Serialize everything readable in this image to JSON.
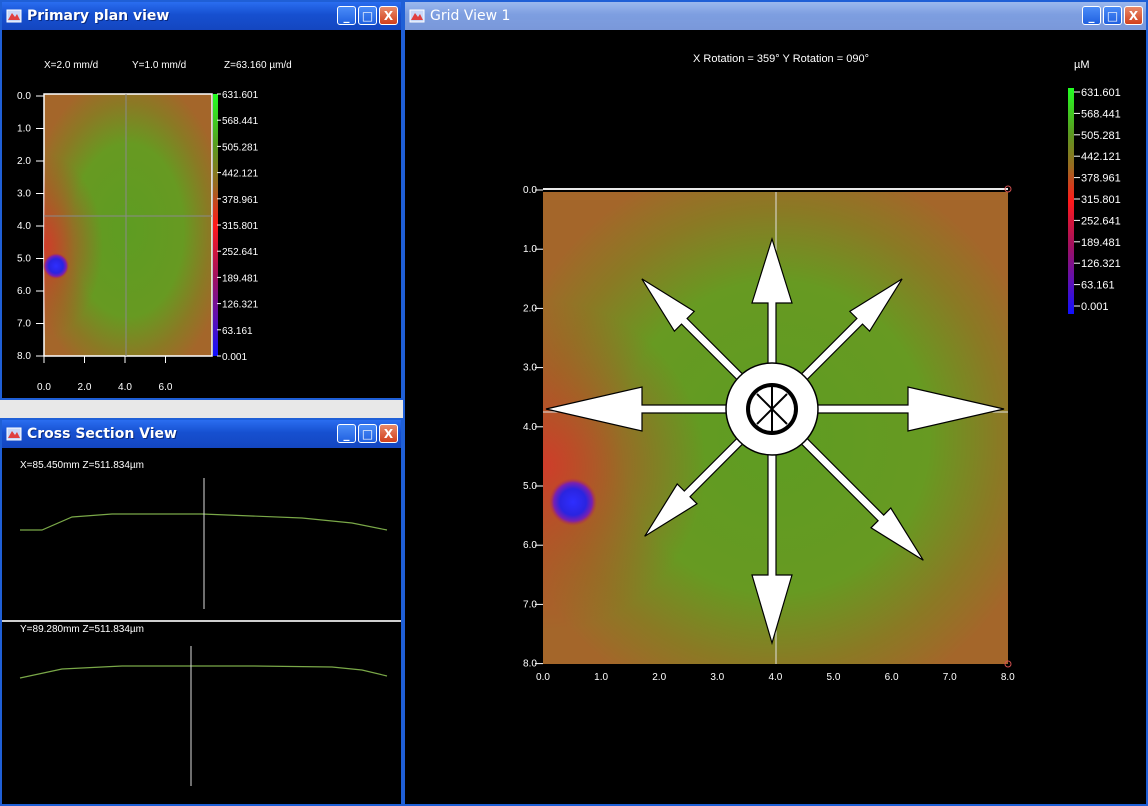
{
  "windows": {
    "plan": {
      "title": "Primary plan view",
      "readout": {
        "x": "X=2.0 mm/d",
        "y": "Y=1.0 mm/d",
        "z": "Z=63.160 µm/d"
      },
      "y_ticks": [
        "0.0",
        "1.0",
        "2.0",
        "3.0",
        "4.0",
        "5.0",
        "6.0",
        "7.0",
        "8.0"
      ],
      "x_ticks": [
        "0.0",
        "2.0",
        "4.0",
        "6.0"
      ],
      "legend": [
        "631.601",
        "568.441",
        "505.281",
        "442.121",
        "378.961",
        "315.801",
        "252.641",
        "189.481",
        "126.321",
        "63.161",
        "0.001"
      ]
    },
    "cross": {
      "title": "Cross Section View",
      "top_readout": "X=85.450mm   Z=511.834µm",
      "bottom_readout": "Y=89.280mm   Z=511.834µm"
    },
    "grid": {
      "title": "Grid View 1",
      "rotation": "X Rotation = 359°     Y Rotation = 090°",
      "unit": "µM",
      "legend": [
        "631.601",
        "568.441",
        "505.281",
        "442.121",
        "378.961",
        "315.801",
        "252.641",
        "189.481",
        "126.321",
        "63.161",
        "0.001"
      ],
      "y_ticks": [
        "0.0",
        "1.0",
        "2.0",
        "3.0",
        "4.0",
        "5.0",
        "6.0",
        "7.0",
        "8.0"
      ],
      "x_ticks": [
        "0.0",
        "1.0",
        "2.0",
        "3.0",
        "4.0",
        "5.0",
        "6.0",
        "7.0",
        "8.0"
      ]
    }
  },
  "buttons": {
    "minimize": "_",
    "maximize": "□",
    "close": "X"
  },
  "colors": {
    "titlebar": "#1650d0",
    "surface_green": "#5f9a22",
    "surface_red": "#c2462a",
    "hotspot_blue": "#2030ff"
  }
}
